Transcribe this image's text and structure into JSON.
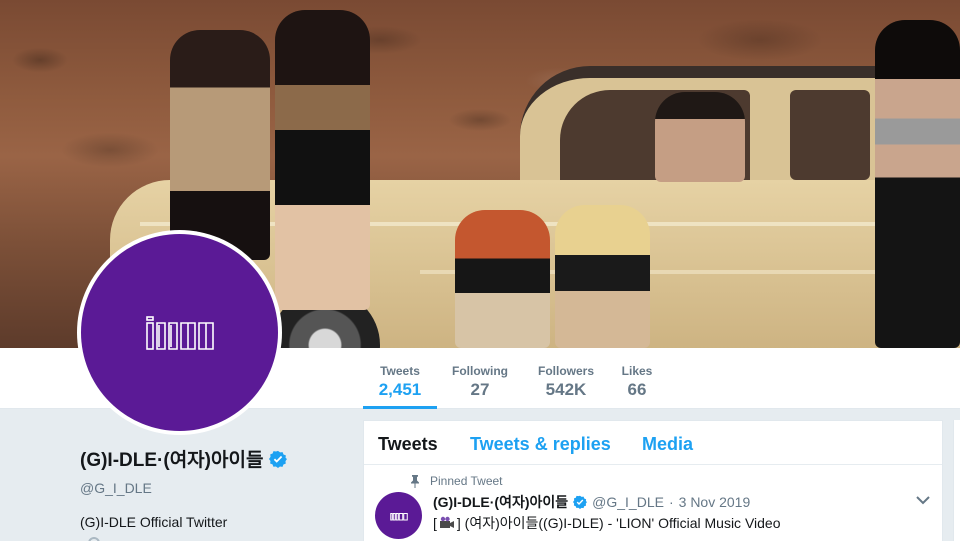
{
  "header_photo": {
    "semantic": "group photo header"
  },
  "stats": [
    {
      "label": "Tweets",
      "value": "2,451",
      "active": true
    },
    {
      "label": "Following",
      "value": "27"
    },
    {
      "label": "Followers",
      "value": "542K"
    },
    {
      "label": "Likes",
      "value": "66"
    }
  ],
  "profile": {
    "name": "(G)I-DLE·(여자)아이들",
    "handle": "@G_I_DLE",
    "bio": "(G)I-DLE Official Twitter",
    "logo_text": "i.D.L.E",
    "avatar_color": "#5b1a96"
  },
  "tabs": [
    {
      "label": "Tweets",
      "active": true
    },
    {
      "label": "Tweets & replies"
    },
    {
      "label": "Media"
    }
  ],
  "pinned_tweet": {
    "pinned_label": "Pinned Tweet",
    "name": "(G)I-DLE·(여자)아이들",
    "handle": "@G_I_DLE",
    "separator": "·",
    "date": "3 Nov 2019",
    "text_prefix": "[",
    "text_body": "] (여자)아이들((G)I-DLE) - 'LION' Official Music Video"
  },
  "colors": {
    "accent": "#1da1f2",
    "brand": "#5b1a96",
    "muted": "#657786"
  }
}
